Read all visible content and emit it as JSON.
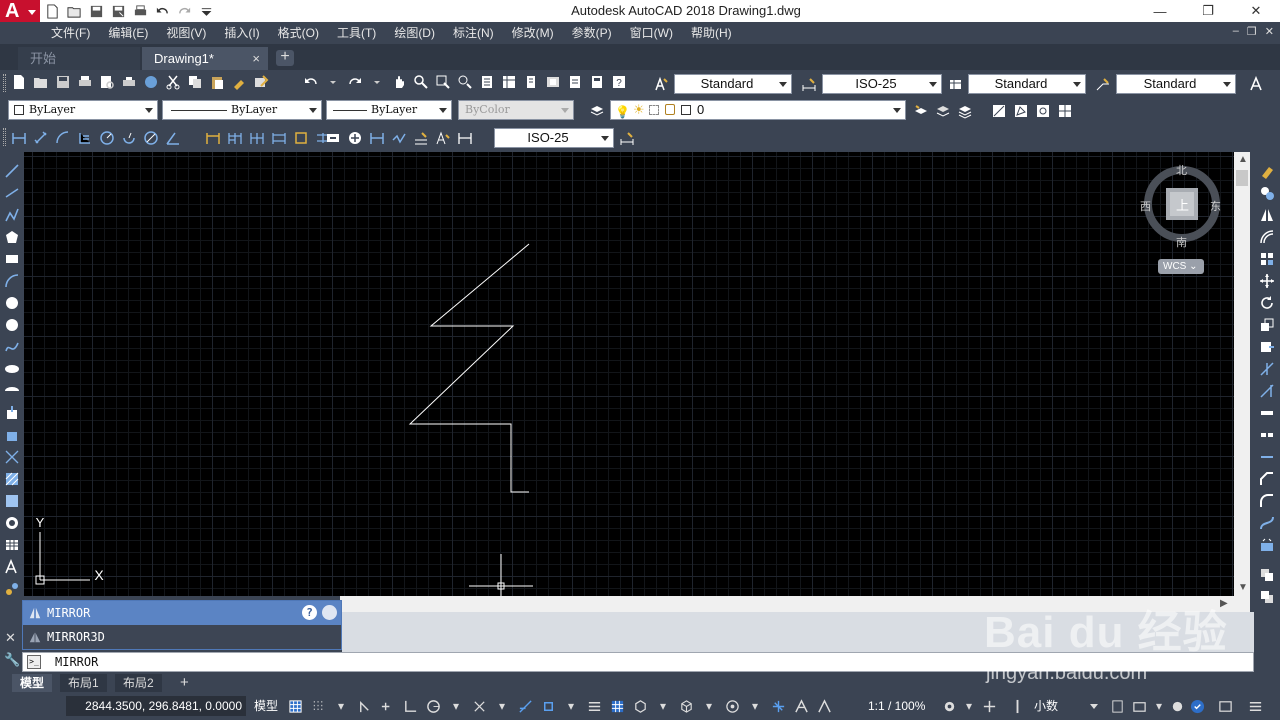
{
  "window": {
    "title": "Autodesk AutoCAD 2018    Drawing1.dwg",
    "logo": "A",
    "minimize_label": "—",
    "restore_label": "❐",
    "close_label": "✕"
  },
  "menu": {
    "items": [
      "文件(F)",
      "编辑(E)",
      "视图(V)",
      "插入(I)",
      "格式(O)",
      "工具(T)",
      "绘图(D)",
      "标注(N)",
      "修改(M)",
      "参数(P)",
      "窗口(W)",
      "帮助(H)"
    ],
    "mdi": [
      "–",
      "❐",
      "✕"
    ]
  },
  "tabs": {
    "start": "开始",
    "drawing": "Drawing1*",
    "close": "×",
    "add": "+"
  },
  "toolbar": {
    "text_style": "Standard",
    "dim_style": "ISO-25",
    "table_style": "Standard",
    "mleader_style": "Standard",
    "color": "ByLayer",
    "linetype": "ByLayer",
    "lineweight": "ByLayer",
    "plot_style": "ByColor",
    "layer": "0",
    "dim_style_2": "ISO-25"
  },
  "viewcube": {
    "north": "北",
    "south": "南",
    "west": "西",
    "east": "东",
    "top": "上",
    "wcs": "WCS"
  },
  "ucs": {
    "x": "X",
    "y": "Y"
  },
  "command": {
    "suggestions": [
      "MIRROR",
      "MIRROR3D"
    ],
    "help": "?",
    "input": "MIRROR"
  },
  "layout_tabs": {
    "model": "模型",
    "layout1": "布局1",
    "layout2": "布局2",
    "add": "+"
  },
  "status": {
    "coords": "2844.3500, 296.8481, 0.0000",
    "model": "模型",
    "scale": "1:1 / 100%",
    "units": "小数"
  },
  "watermark": {
    "text": "Bai du 经验",
    "url": "jingyan.baidu.com"
  },
  "colors": {
    "background": "#3b4453",
    "canvas": "#000000",
    "accent": "#5b84c4",
    "logo": "#c8102e"
  }
}
